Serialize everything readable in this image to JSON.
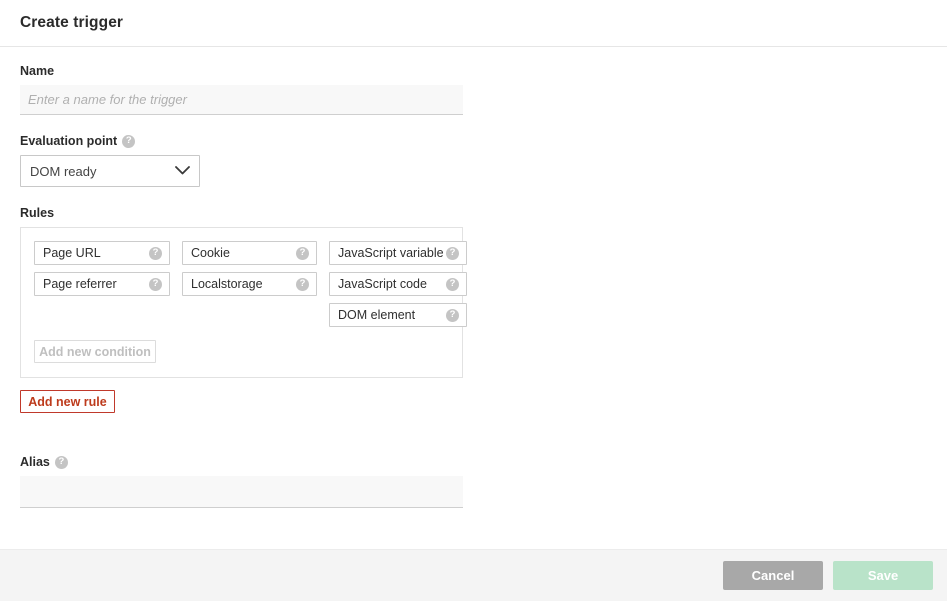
{
  "header": {
    "title": "Create trigger"
  },
  "form": {
    "name": {
      "label": "Name",
      "placeholder": "Enter a name for the trigger",
      "value": ""
    },
    "evaluation_point": {
      "label": "Evaluation point",
      "help_icon": "help-circle-icon",
      "selected": "DOM ready",
      "options": [
        "DOM ready"
      ],
      "chevron_icon": "chevron-down-icon"
    },
    "rules": {
      "label": "Rules",
      "columns": [
        {
          "conditions": [
            {
              "label": "Page URL",
              "help_icon": "help-circle-icon"
            },
            {
              "label": "Page referrer",
              "help_icon": "help-circle-icon"
            }
          ]
        },
        {
          "conditions": [
            {
              "label": "Cookie",
              "help_icon": "help-circle-icon"
            },
            {
              "label": "Localstorage",
              "help_icon": "help-circle-icon"
            }
          ]
        },
        {
          "conditions": [
            {
              "label": "JavaScript variable",
              "help_icon": "help-circle-icon"
            },
            {
              "label": "JavaScript code",
              "help_icon": "help-circle-icon"
            },
            {
              "label": "DOM element",
              "help_icon": "help-circle-icon"
            }
          ]
        }
      ],
      "add_condition_label": "Add new condition",
      "add_rule_label": "Add new rule"
    },
    "alias": {
      "label": "Alias",
      "help_icon": "help-circle-icon",
      "placeholder": "",
      "value": ""
    }
  },
  "footer": {
    "cancel_label": "Cancel",
    "save_label": "Save"
  },
  "colors": {
    "accent_red": "#bd3b1c",
    "cancel_gray": "#a8a8a8",
    "save_green": "#b9e3c9",
    "footer_bg": "#f4f4f4",
    "input_bg": "#f8f8f8",
    "help_icon_gray": "#c4c4c4"
  }
}
